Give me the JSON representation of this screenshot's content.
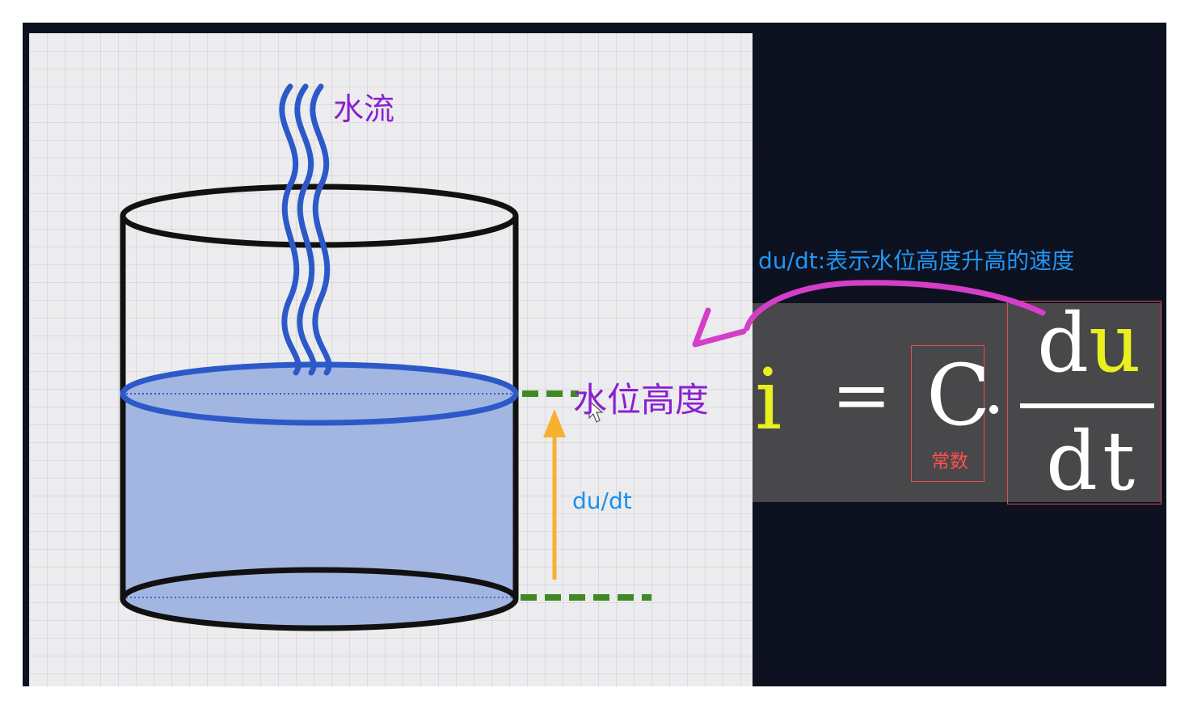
{
  "diagram": {
    "water_flow_label": "水流",
    "water_level_label": "水位高度",
    "rate_label": "du/dt"
  },
  "annotation": {
    "text": "du/dt:表示水位高度升高的速度"
  },
  "formula": {
    "lhs": "i",
    "equals": "=",
    "constant_symbol": "C",
    "constant_label": "常数",
    "numerator_d": "d",
    "numerator_u": "u",
    "denominator": "dt"
  },
  "colors": {
    "water_fill": "#a3b6e2",
    "water_stream": "#2d59c8",
    "level_dash": "#3f8a25",
    "rate_arrow": "#f7b030",
    "pointer_arrow": "#d43ec8",
    "label_purple": "#8a1fd0",
    "label_blue": "#1a90e8",
    "highlight_yellow": "#e8f020",
    "box_red": "#e05050"
  }
}
